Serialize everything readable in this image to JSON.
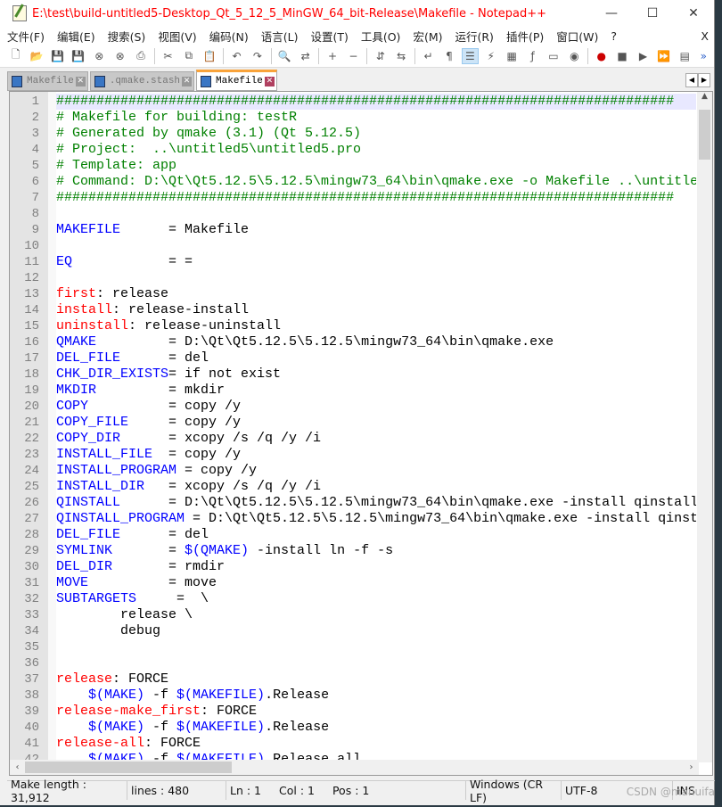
{
  "window": {
    "title": "E:\\test\\build-untitled5-Desktop_Qt_5_12_5_MinGW_64_bit-Release\\Makefile - Notepad++",
    "minimize": "—",
    "maximize": "☐",
    "close": "✕"
  },
  "menu": {
    "items": [
      "文件(F)",
      "编辑(E)",
      "搜索(S)",
      "视图(V)",
      "编码(N)",
      "语言(L)",
      "设置(T)",
      "工具(O)",
      "宏(M)",
      "运行(R)",
      "插件(P)",
      "窗口(W)",
      "?"
    ],
    "close": "X"
  },
  "toolbar": {
    "icons": [
      "new-file",
      "open-file",
      "save",
      "save-all",
      "close",
      "close-all",
      "print",
      "|",
      "cut",
      "copy",
      "paste",
      "|",
      "undo",
      "redo",
      "|",
      "find",
      "replace",
      "|",
      "zoom-in",
      "zoom-out",
      "|",
      "sync-v",
      "sync-h",
      "|",
      "word-wrap",
      "show-all",
      "indent-guide",
      "udl",
      "doc-map",
      "function-list",
      "folder-workspace",
      "monitor",
      "|",
      "record-macro",
      "stop-macro",
      "play-macro",
      "run-macro-multiple",
      "save-macro"
    ],
    "overflow": "»"
  },
  "tabs": [
    {
      "label": "Makefile",
      "active": false
    },
    {
      "label": ".qmake.stash",
      "active": false
    },
    {
      "label": "Makefile",
      "active": true
    }
  ],
  "editor": {
    "lines": [
      [
        [
          "c",
          "#############################################################################"
        ]
      ],
      [
        [
          "c",
          "# Makefile for building: testR"
        ]
      ],
      [
        [
          "c",
          "# Generated by qmake (3.1) (Qt 5.12.5)"
        ]
      ],
      [
        [
          "c",
          "# Project:  ..\\untitled5\\untitled5.pro"
        ]
      ],
      [
        [
          "c",
          "# Template: app"
        ]
      ],
      [
        [
          "c",
          "# Command: D:\\Qt\\Qt5.12.5\\5.12.5\\mingw73_64\\bin\\qmake.exe -o Makefile ..\\untitle"
        ]
      ],
      [
        [
          "c",
          "#############################################################################"
        ]
      ],
      [],
      [
        [
          "v",
          "MAKEFILE"
        ],
        [
          "p",
          "      = Makefile"
        ]
      ],
      [],
      [
        [
          "v",
          "EQ"
        ],
        [
          "p",
          "            = ="
        ]
      ],
      [],
      [
        [
          "t",
          "first"
        ],
        [
          "p",
          ": release"
        ]
      ],
      [
        [
          "t",
          "install"
        ],
        [
          "p",
          ": release-install"
        ]
      ],
      [
        [
          "t",
          "uninstall"
        ],
        [
          "p",
          ": release-uninstall"
        ]
      ],
      [
        [
          "v",
          "QMAKE"
        ],
        [
          "p",
          "         = D:\\Qt\\Qt5.12.5\\5.12.5\\mingw73_64\\bin\\qmake.exe"
        ]
      ],
      [
        [
          "v",
          "DEL_FILE"
        ],
        [
          "p",
          "      = del"
        ]
      ],
      [
        [
          "v",
          "CHK_DIR_EXISTS"
        ],
        [
          "p",
          "= if not exist"
        ]
      ],
      [
        [
          "v",
          "MKDIR"
        ],
        [
          "p",
          "         = mkdir"
        ]
      ],
      [
        [
          "v",
          "COPY"
        ],
        [
          "p",
          "          = copy /y"
        ]
      ],
      [
        [
          "v",
          "COPY_FILE"
        ],
        [
          "p",
          "     = copy /y"
        ]
      ],
      [
        [
          "v",
          "COPY_DIR"
        ],
        [
          "p",
          "      = xcopy /s /q /y /i"
        ]
      ],
      [
        [
          "v",
          "INSTALL_FILE"
        ],
        [
          "p",
          "  = copy /y"
        ]
      ],
      [
        [
          "v",
          "INSTALL_PROGRAM"
        ],
        [
          "p",
          " = copy /y"
        ]
      ],
      [
        [
          "v",
          "INSTALL_DIR"
        ],
        [
          "p",
          "   = xcopy /s /q /y /i"
        ]
      ],
      [
        [
          "v",
          "QINSTALL"
        ],
        [
          "p",
          "      = D:\\Qt\\Qt5.12.5\\5.12.5\\mingw73_64\\bin\\qmake.exe -install qinstall"
        ]
      ],
      [
        [
          "v",
          "QINSTALL_PROGRAM"
        ],
        [
          "p",
          " = D:\\Qt\\Qt5.12.5\\5.12.5\\mingw73_64\\bin\\qmake.exe -install qinst"
        ]
      ],
      [
        [
          "v",
          "DEL_FILE"
        ],
        [
          "p",
          "      = del"
        ]
      ],
      [
        [
          "v",
          "SYMLINK"
        ],
        [
          "p",
          "       = "
        ],
        [
          "m",
          "$(QMAKE)"
        ],
        [
          "p",
          " -install ln -f -s"
        ]
      ],
      [
        [
          "v",
          "DEL_DIR"
        ],
        [
          "p",
          "       = rmdir"
        ]
      ],
      [
        [
          "v",
          "MOVE"
        ],
        [
          "p",
          "          = move"
        ]
      ],
      [
        [
          "v",
          "SUBTARGETS"
        ],
        [
          "p",
          "     =  \\"
        ]
      ],
      [
        [
          "p",
          "        release \\"
        ]
      ],
      [
        [
          "p",
          "        debug"
        ]
      ],
      [],
      [],
      [
        [
          "t",
          "release"
        ],
        [
          "p",
          ": FORCE"
        ]
      ],
      [
        [
          "p",
          "    "
        ],
        [
          "m",
          "$(MAKE)"
        ],
        [
          "p",
          " -f "
        ],
        [
          "m",
          "$(MAKEFILE)"
        ],
        [
          "p",
          ".Release"
        ]
      ],
      [
        [
          "t",
          "release-make_first"
        ],
        [
          "p",
          ": FORCE"
        ]
      ],
      [
        [
          "p",
          "    "
        ],
        [
          "m",
          "$(MAKE)"
        ],
        [
          "p",
          " -f "
        ],
        [
          "m",
          "$(MAKEFILE)"
        ],
        [
          "p",
          ".Release"
        ]
      ],
      [
        [
          "t",
          "release-all"
        ],
        [
          "p",
          ": FORCE"
        ]
      ],
      [
        [
          "p",
          "    "
        ],
        [
          "m",
          "$(MAKE)"
        ],
        [
          "p",
          " -f "
        ],
        [
          "m",
          "$(MAKEFILE)"
        ],
        [
          "p",
          ".Release all"
        ]
      ]
    ],
    "current_line": 1
  },
  "status": {
    "length": "Make length : 31,912",
    "lines": "lines : 480",
    "ln": "Ln : 1",
    "col": "Col : 1",
    "pos": "Pos : 1",
    "eol": "Windows (CR LF)",
    "encoding": "UTF-8",
    "mode": "INS"
  },
  "watermark": "CSDN @manuifa"
}
